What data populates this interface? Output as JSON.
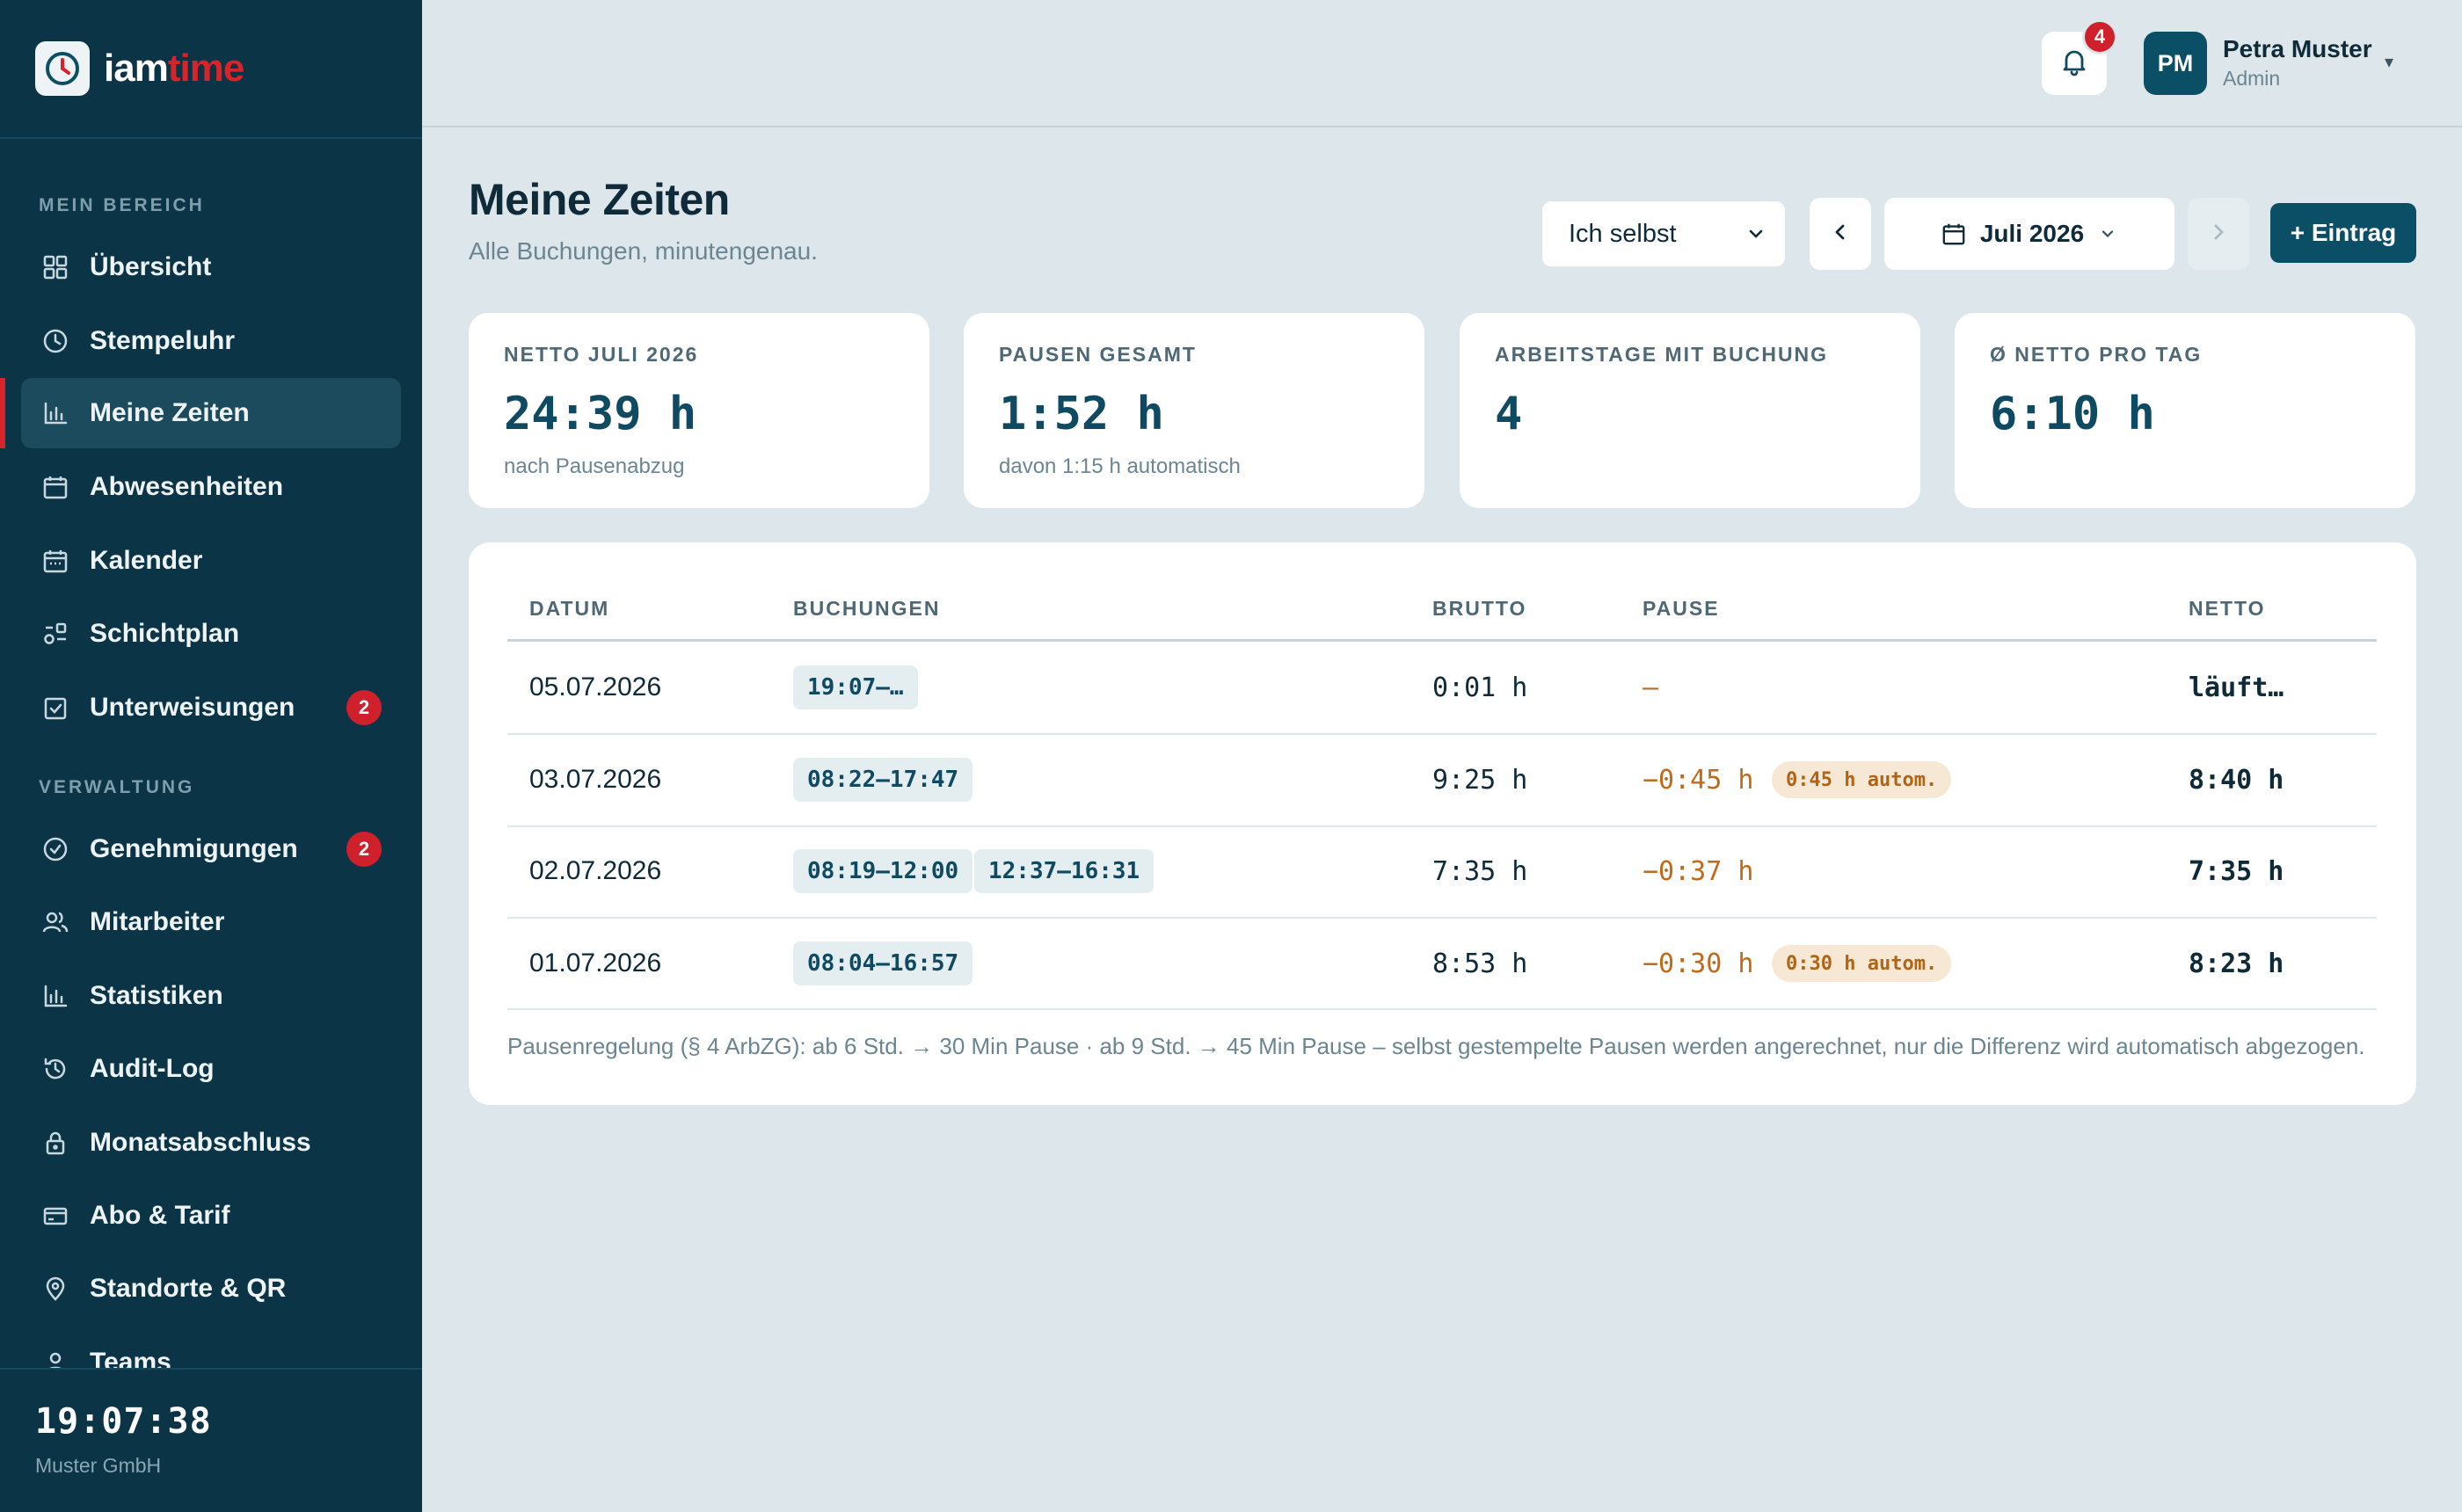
{
  "brand": {
    "name_a": "iam",
    "name_b": "time"
  },
  "sidebar": {
    "section_1": "MEIN BEREICH",
    "section_2": "VERWALTUNG",
    "items": [
      {
        "label": "Übersicht",
        "icon": "grid-icon"
      },
      {
        "label": "Stempeluhr",
        "icon": "clock-icon"
      },
      {
        "label": "Meine Zeiten",
        "icon": "bar-chart-icon",
        "active": true
      },
      {
        "label": "Abwesenheiten",
        "icon": "calendar-icon"
      },
      {
        "label": "Kalender",
        "icon": "calendar-icon"
      },
      {
        "label": "Schichtplan",
        "icon": "shift-icon"
      },
      {
        "label": "Unterweisungen",
        "icon": "checkbox-icon",
        "badge": "2"
      },
      {
        "label": "Genehmigungen",
        "icon": "check-circle-icon",
        "badge": "2"
      },
      {
        "label": "Mitarbeiter",
        "icon": "users-icon"
      },
      {
        "label": "Statistiken",
        "icon": "bar-chart-icon"
      },
      {
        "label": "Audit-Log",
        "icon": "history-icon"
      },
      {
        "label": "Monatsabschluss",
        "icon": "lock-icon"
      },
      {
        "label": "Abo & Tarif",
        "icon": "credit-card-icon"
      },
      {
        "label": "Standorte & QR",
        "icon": "map-pin-icon"
      },
      {
        "label": "Teams",
        "icon": "user-icon"
      }
    ],
    "clock": "19:07:38",
    "company": "Muster GmbH"
  },
  "topbar": {
    "notifications": "4",
    "avatar_initials": "PM",
    "user_name": "Petra Muster",
    "user_role": "Admin",
    "caret": "▾"
  },
  "header": {
    "title": "Meine Zeiten",
    "subtitle": "Alle Buchungen, minutengenau.",
    "person_select": "Ich selbst",
    "month": "Juli 2026",
    "add_button": "+ Eintrag"
  },
  "stats": [
    {
      "label": "NETTO JULI 2026",
      "value": "24:39 h",
      "note": "nach Pausenabzug"
    },
    {
      "label": "PAUSEN GESAMT",
      "value": "1:52 h",
      "note": "davon 1:15 h automatisch"
    },
    {
      "label": "ARBEITSTAGE MIT BUCHUNG",
      "value": "4",
      "note": ""
    },
    {
      "label": "Ø NETTO PRO TAG",
      "value": "6:10 h",
      "note": ""
    }
  ],
  "table": {
    "headers": {
      "date": "DATUM",
      "bookings": "BUCHUNGEN",
      "brutto": "BRUTTO",
      "pause": "PAUSE",
      "netto": "NETTO"
    },
    "rows": [
      {
        "date": "05.07.2026",
        "bookings": [
          "19:07–…"
        ],
        "brutto": "0:01 h",
        "pause": "–",
        "auto": "",
        "netto": "läuft…"
      },
      {
        "date": "03.07.2026",
        "bookings": [
          "08:22–17:47"
        ],
        "brutto": "9:25 h",
        "pause": "−0:45 h",
        "auto": "0:45 h autom.",
        "netto": "8:40 h"
      },
      {
        "date": "02.07.2026",
        "bookings": [
          "08:19–12:00",
          "12:37–16:31"
        ],
        "brutto": "7:35 h",
        "pause": "−0:37 h",
        "auto": "",
        "netto": "7:35 h"
      },
      {
        "date": "01.07.2026",
        "bookings": [
          "08:04–16:57"
        ],
        "brutto": "8:53 h",
        "pause": "−0:30 h",
        "auto": "0:30 h autom.",
        "netto": "8:23 h"
      }
    ],
    "footnote": "Pausenregelung (§ 4 ArbZG): ab 6 Std. → 30 Min Pause · ab 9 Std. → 45 Min Pause – selbst gestempelte Pausen werden angerechnet, nur die Differenz wird automatisch abgezogen."
  },
  "colors": {
    "sidebar": "#0b3547",
    "accent": "#0b4f66",
    "brand_red": "#d8232a",
    "pause": "#c26a1a",
    "background": "#dde6ea"
  }
}
